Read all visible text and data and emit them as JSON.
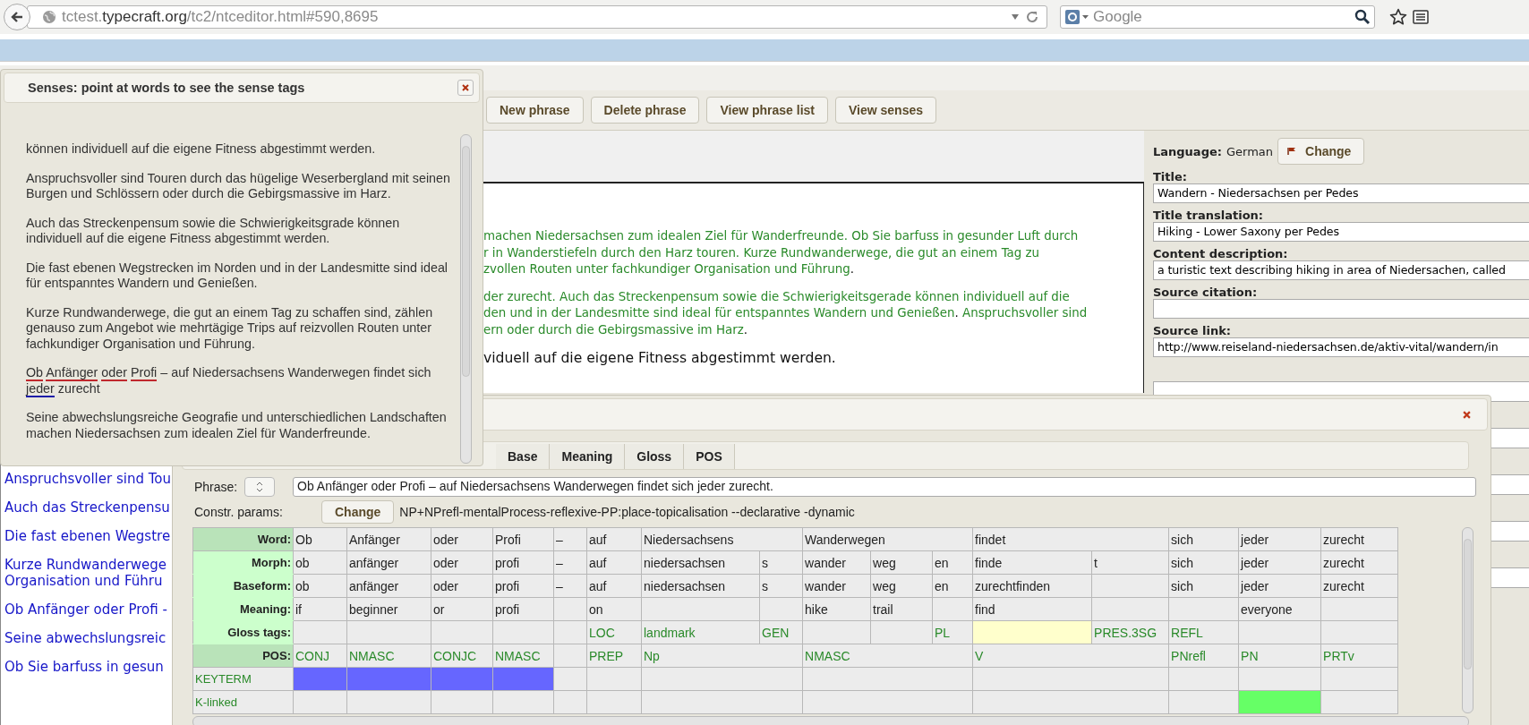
{
  "browser": {
    "url": {
      "subdomain": "tctest.",
      "domain": "typecraft.org",
      "path": "/tc2/ntceditor.html#590,8695"
    },
    "search": {
      "placeholder": "Google"
    }
  },
  "toolbar": {
    "buttons": [
      "New phrase",
      "Delete phrase",
      "View phrase list",
      "View senses"
    ]
  },
  "text_list": {
    "items": [
      {
        "lines": [
          "Anspruchsvoller sind Tou"
        ]
      },
      {
        "lines": [
          "Auch das Streckenpensu"
        ]
      },
      {
        "lines": [
          "Die fast ebenen Wegstre"
        ]
      },
      {
        "lines": [
          "Kurze Rundwanderwege",
          "Organisation und Führu"
        ]
      },
      {
        "lines": [
          "Ob Anfänger oder Profi -"
        ]
      },
      {
        "lines": [
          "Seine abwechslungsreic"
        ]
      },
      {
        "lines": [
          "Ob Sie barfuss in gesun"
        ]
      }
    ]
  },
  "editor": {
    "paragraphs": [
      {
        "kind": "annotated",
        "lines": [
          [
            {
              "text": "machen Niedersachsen zum idealen Ziel für Wanderfreunde. Ob Sie barfuss in gesunder Luft durch",
              "kind": "annotated"
            }
          ],
          [
            {
              "text": "r in Wanderstiefeln durch den Harz touren. Kurze Rundwanderwege, die gut an einem Tag zu",
              "kind": "annotated"
            }
          ],
          [
            {
              "text": "zvollen Routen unter fachkundiger Organisation und Führung",
              "kind": "annotated"
            },
            {
              "text": ".",
              "kind": "plain"
            }
          ]
        ]
      },
      {
        "kind": "annotated",
        "lines": [
          [
            {
              "text": "der zurecht. Auch das Streckenpensum sowie die Schwierigkeitsgerade können individuell auf die",
              "kind": "annotated"
            }
          ],
          [
            {
              "text": "den und in der Landesmitte sind ideal für entspanntes Wandern und Genießen",
              "kind": "annotated"
            },
            {
              "text": ". ",
              "kind": "plain"
            },
            {
              "text": "Anspruchsvoller sind",
              "kind": "annotated"
            }
          ],
          [
            {
              "text": "ern oder durch die Gebirgsmassive im Harz",
              "kind": "annotated"
            },
            {
              "text": ".",
              "kind": "plain"
            }
          ]
        ]
      },
      {
        "kind": "current",
        "lines": [
          [
            {
              "text": "viduell auf die eigene Fitness abgestimmt werden.",
              "kind": "plain"
            }
          ]
        ]
      }
    ]
  },
  "metadata": {
    "language_label": "Language:",
    "language": "German",
    "change_button": "Change",
    "fields": [
      {
        "label": "Title:",
        "value": "Wandern - Niedersachsen per Pedes"
      },
      {
        "label": "Title translation:",
        "value": "Hiking - Lower Saxony per Pedes"
      },
      {
        "label": "Content description:",
        "value": "a turistic text describing hiking in area of Niedersachen, called"
      },
      {
        "label": "Source citation:"
      },
      {
        "label": "Source link:",
        "value": "http://www.reiseland-niedersachsen.de/aktiv-vital/wandern/in"
      }
    ]
  },
  "senses_dialog": {
    "title": "Senses: point at words to see the sense tags",
    "paragraphs": [
      {
        "text": "können individuell auf die eigene Fitness abgestimmt werden."
      },
      {
        "text": "Anspruchsvoller sind Touren durch das hügelige Weserbergland mit seinen Burgen und Schlössern oder durch die Gebirgsmassive im Harz."
      },
      {
        "text": "Auch das Streckenpensum sowie die Schwierigkeitsgrade können individuell auf die eigene Fitness abgestimmt werden."
      },
      {
        "text": "Die fast ebenen Wegstrecken im Norden und in der Landesmitte sind ideal für entspanntes Wandern und Genießen."
      },
      {
        "text": "Kurze Rundwanderwege, die gut an einem Tag zu schaffen sind, zählen genauso zum Angebot wie mehrtägige Trips auf reizvollen Routen unter fachkundiger Organisation und Führung."
      },
      {
        "tokens": [
          {
            "text": "Ob",
            "color": "#c0282d"
          },
          {
            "text": "Anfänger",
            "color": "#c0282d"
          },
          {
            "text": "oder",
            "color": "#c0282d"
          },
          {
            "text": "Profi",
            "color": "#c0282d"
          },
          {
            "text": "– auf Niedersachsens Wanderwegen findet sich"
          },
          {
            "text": "jeder",
            "color": "#1c1ca8"
          },
          {
            "text": "zurecht"
          }
        ]
      },
      {
        "text": "Seine abwechslungsreiche Geografie und unterschiedlichen Landschaften machen Niedersachsen zum idealen Ziel für Wanderfreunde."
      }
    ]
  },
  "phrase_dialog": {
    "tabs": [
      {
        "label": "Base",
        "selected": false
      },
      {
        "label": "Meaning",
        "selected": false
      },
      {
        "label": "Gloss",
        "selected": false
      },
      {
        "label": "POS",
        "selected": false
      }
    ],
    "phrase_label": "Phrase:",
    "phrase": "Ob Anfänger oder Profi – auf Niedersachsens Wanderwegen findet sich jeder zurecht.",
    "params_label": "Constr. params:",
    "params_button": "Change",
    "params": "NP+NPrefl-mentalProcess-reflexive-PP:place-topicalisation --declarative -dynamic",
    "row_labels": {
      "word": "Word:",
      "morph": "Morph:",
      "baseform": "Baseform:",
      "meaning": "Meaning:",
      "gloss": "Gloss tags:",
      "pos": "POS:",
      "keyterm": "KEYTERM",
      "k_linked": "K-linked"
    },
    "words": [
      {
        "word": "Ob",
        "pos": "CONJ",
        "keyterm": {
          "color": "#6666ff"
        },
        "morphs": [
          {
            "morph": "ob",
            "baseform": "ob",
            "meaning": "if"
          }
        ]
      },
      {
        "word": "Anfänger",
        "pos": "NMASC",
        "keyterm": {
          "color": "#6666ff"
        },
        "morphs": [
          {
            "morph": "anfänger",
            "baseform": "anfänger",
            "meaning": "beginner"
          }
        ]
      },
      {
        "word": "oder",
        "pos": "CONJC",
        "keyterm": {
          "color": "#6666ff"
        },
        "morphs": [
          {
            "morph": "oder",
            "baseform": "oder",
            "meaning": "or"
          }
        ]
      },
      {
        "word": "Profi",
        "pos": "NMASC",
        "keyterm": {
          "color": "#6666ff"
        },
        "morphs": [
          {
            "morph": "profi",
            "baseform": "profi",
            "meaning": "profi"
          }
        ]
      },
      {
        "word": "–",
        "morphs": [
          {
            "morph": "–",
            "baseform": "–"
          }
        ]
      },
      {
        "word": "auf",
        "pos": "PREP",
        "morphs": [
          {
            "morph": "auf",
            "baseform": "auf",
            "meaning": "on",
            "gloss": "LOC"
          }
        ]
      },
      {
        "word": "Niedersachsens",
        "pos": "Np",
        "morphs": [
          {
            "morph": "niedersachsen",
            "baseform": "niedersachsen",
            "gloss": "landmark"
          },
          {
            "morph": "s",
            "baseform": "s",
            "gloss": "GEN"
          }
        ]
      },
      {
        "word": "Wanderwegen",
        "pos": "NMASC",
        "morphs": [
          {
            "morph": "wander",
            "baseform": "wander",
            "meaning": "hike"
          },
          {
            "morph": "weg",
            "baseform": "weg",
            "meaning": "trail"
          },
          {
            "morph": "en",
            "baseform": "en",
            "gloss": "PL"
          }
        ]
      },
      {
        "word": "findet",
        "pos": "V",
        "morphs": [
          {
            "morph": "finde",
            "baseform": "zurechtfinden",
            "meaning": "find",
            "gloss_cell": {
              "color": "#ffffcc"
            }
          },
          {
            "morph": "t",
            "gloss": "PRES.3SG"
          }
        ]
      },
      {
        "word": "sich",
        "pos": "PNrefl",
        "morphs": [
          {
            "morph": "sich",
            "baseform": "sich",
            "gloss": "REFL"
          }
        ]
      },
      {
        "word": "jeder",
        "pos": "PN",
        "k_linked": {
          "color": "#66ff66"
        },
        "morphs": [
          {
            "morph": "jeder",
            "baseform": "jeder",
            "meaning": "everyone"
          }
        ]
      },
      {
        "word": "zurecht",
        "pos": "PRTv",
        "morphs": [
          {
            "morph": "zurecht",
            "baseform": "zurecht"
          }
        ]
      }
    ]
  }
}
